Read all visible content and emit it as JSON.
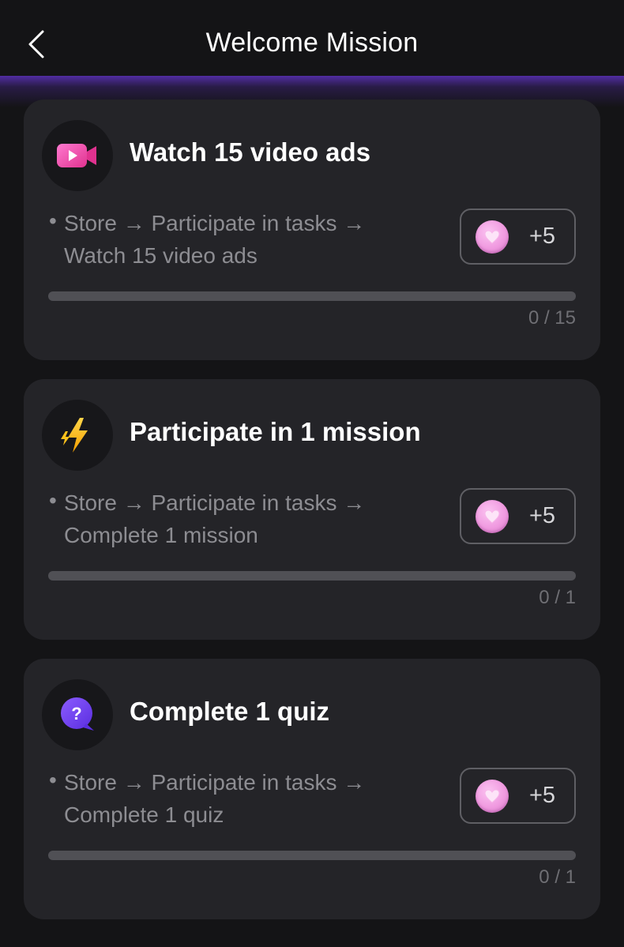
{
  "header": {
    "title": "Welcome Mission",
    "back_icon": "chevron-left-icon"
  },
  "missions": [
    {
      "icon": "video-camera-icon",
      "title": "Watch 15 video ads",
      "bullet": "•",
      "desc_line1": "Store → Participate in tasks →",
      "desc_line2": "Watch 15 video ads",
      "reward_icon": "heart-coin-icon",
      "reward": "+5",
      "progress_text": "0 / 15",
      "progress": 0
    },
    {
      "icon": "lightning-icon",
      "title": "Participate in 1 mission",
      "bullet": "•",
      "desc_line1": "Store → Participate in tasks →",
      "desc_line2": "Complete 1 mission",
      "reward_icon": "heart-coin-icon",
      "reward": "+5",
      "progress_text": "0 / 1",
      "progress": 0
    },
    {
      "icon": "question-bubble-icon",
      "title": "Complete 1 quiz",
      "bullet": "•",
      "desc_line1": "Store → Participate in tasks →",
      "desc_line2": "Complete 1 quiz",
      "reward_icon": "heart-coin-icon",
      "reward": "+5",
      "progress_text": "0 / 1",
      "progress": 0
    }
  ],
  "colors": {
    "background": "#141416",
    "card": "#242428",
    "accent_glow": "#542eaa",
    "coin": "#f09ae0"
  }
}
